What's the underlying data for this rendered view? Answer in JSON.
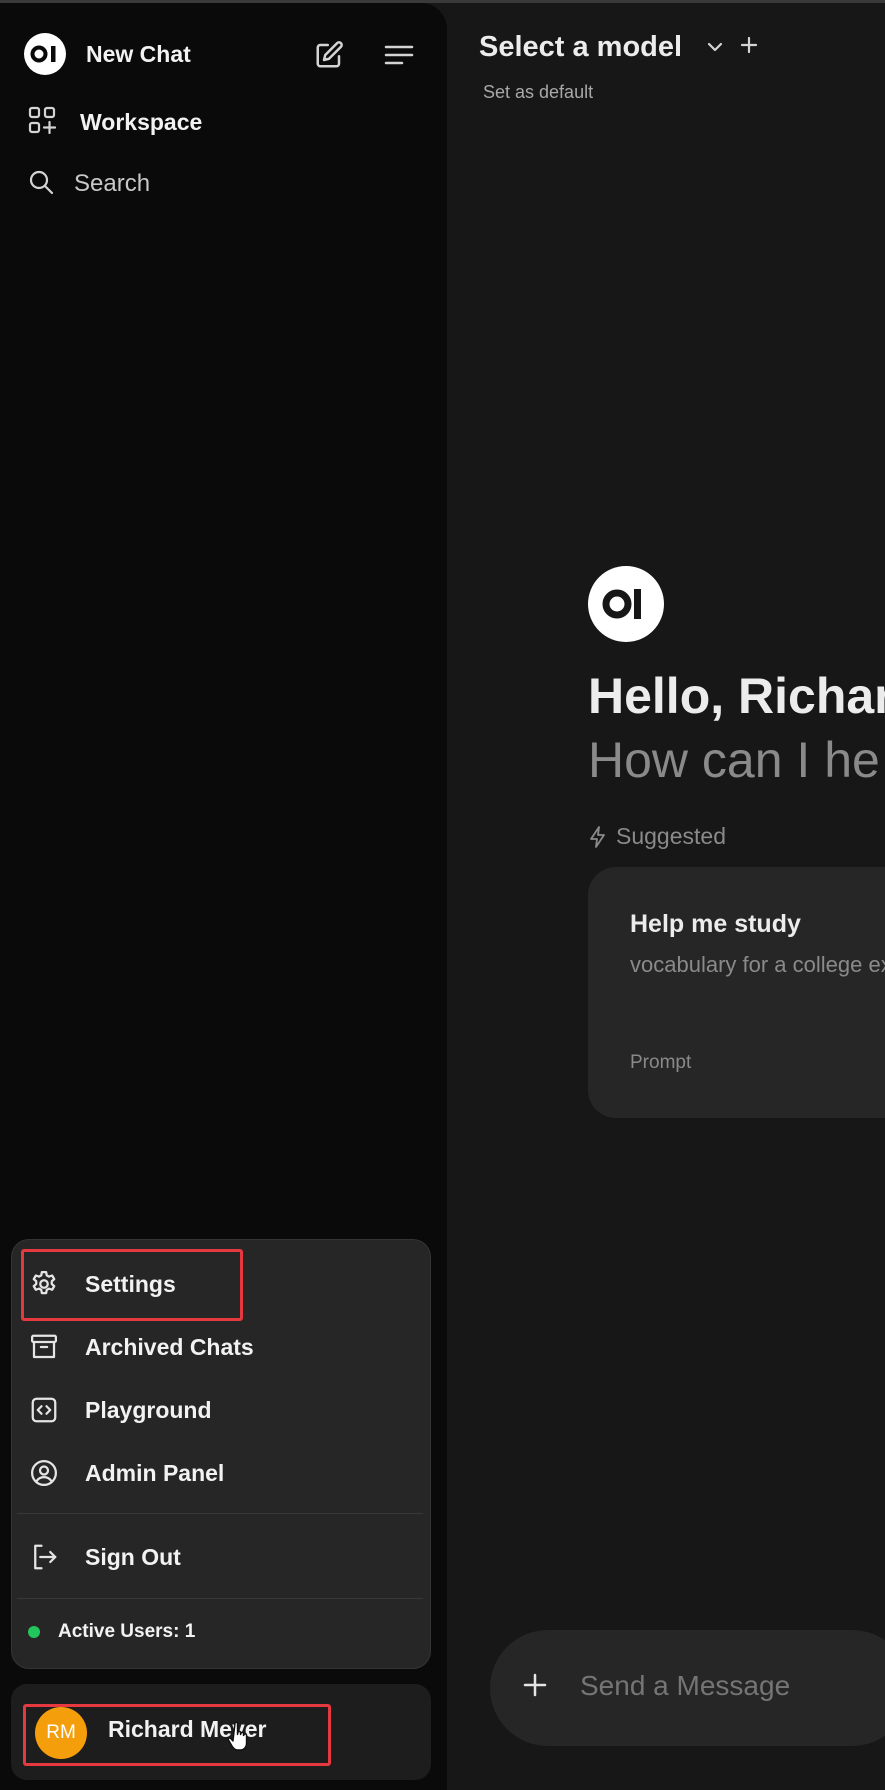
{
  "sidebar": {
    "new_chat_label": "New Chat",
    "workspace_label": "Workspace",
    "search_label": "Search"
  },
  "user_menu": {
    "items": [
      {
        "label": "Settings",
        "icon": "gear-icon"
      },
      {
        "label": "Archived Chats",
        "icon": "archive-icon"
      },
      {
        "label": "Playground",
        "icon": "code-icon"
      },
      {
        "label": "Admin Panel",
        "icon": "user-circle-icon"
      },
      {
        "label": "Sign Out",
        "icon": "sign-out-icon"
      }
    ],
    "active_users_label": "Active Users: 1",
    "status_color": "#22c55e"
  },
  "user": {
    "initials": "RM",
    "name": "Richard Meyer",
    "avatar_color": "#f59e0b"
  },
  "header": {
    "model_title": "Select a model",
    "set_default": "Set as default"
  },
  "welcome": {
    "greeting": "Hello, Richar",
    "subtitle": "How can I he",
    "suggested_label": "Suggested"
  },
  "suggestion_card": {
    "title": "Help me study",
    "description": "vocabulary for a college exam",
    "tag": "Prompt"
  },
  "composer": {
    "placeholder": "Send a Message"
  },
  "colors": {
    "highlight": "#e5383f",
    "sidebar_bg": "#0a0a0a",
    "main_bg": "#171717"
  }
}
